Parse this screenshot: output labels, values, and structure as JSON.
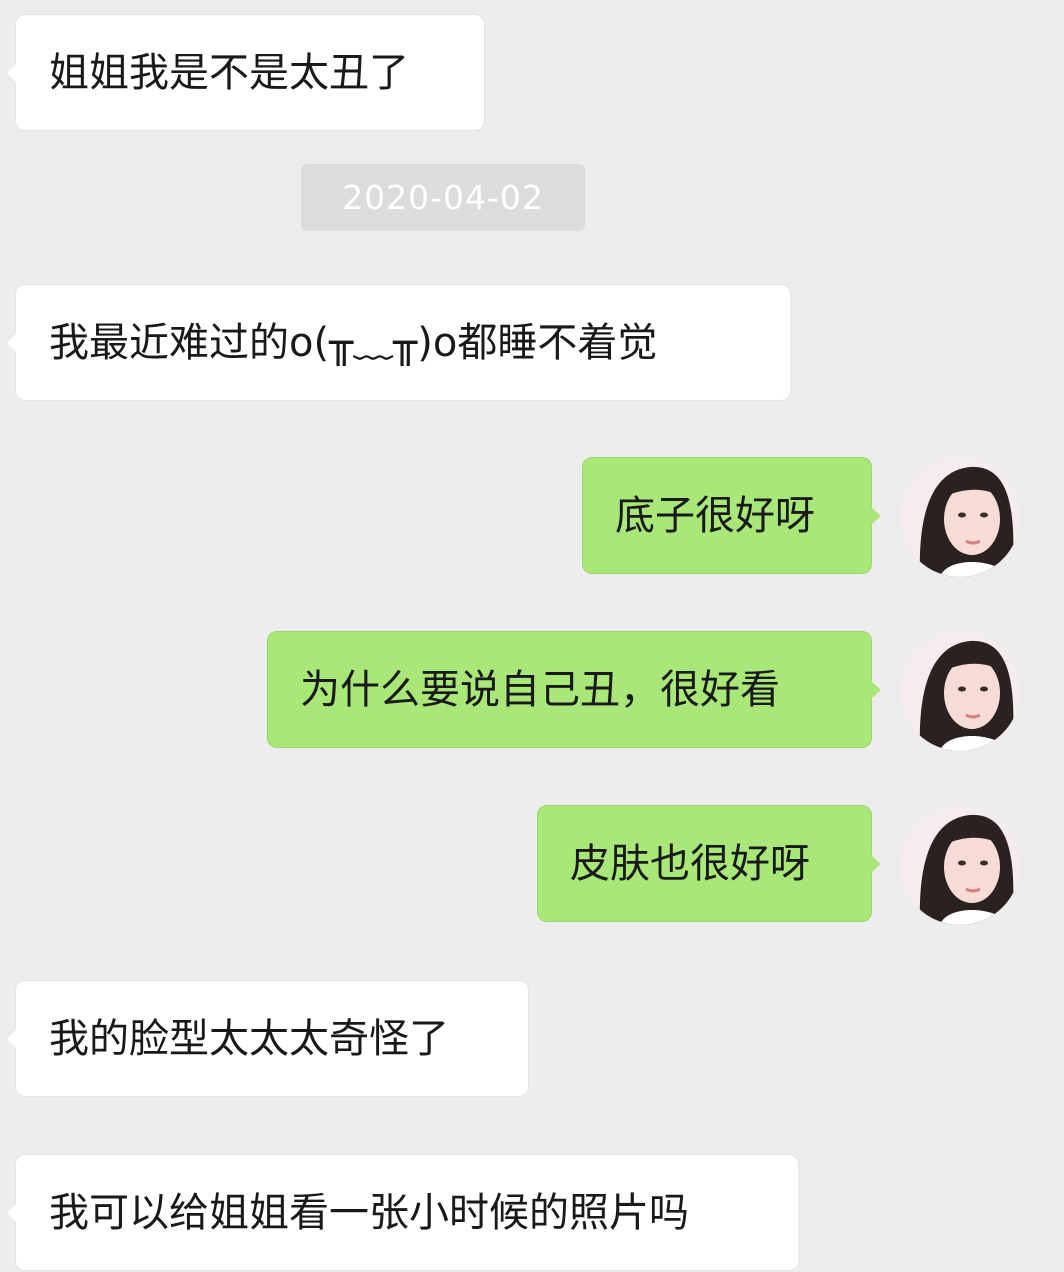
{
  "chat": {
    "timestamp": "2020-04-02",
    "messages": [
      {
        "side": "left",
        "text": "姐姐我是不是太丑了"
      },
      {
        "side": "left",
        "text": "我最近难过的o(╥﹏╥)o都睡不着觉"
      },
      {
        "side": "right",
        "text": "底子很好呀"
      },
      {
        "side": "right",
        "text": "为什么要说自己丑，很好看"
      },
      {
        "side": "right",
        "text": "皮肤也很好呀"
      },
      {
        "side": "left",
        "text": "我的脸型太太太奇怪了"
      },
      {
        "side": "left",
        "text": "我可以给姐姐看一张小时候的照片吗"
      }
    ],
    "avatar_icon": "woman-portrait-avatar",
    "colors": {
      "background": "#ededed",
      "incoming_bubble": "#ffffff",
      "outgoing_bubble": "#a9e878",
      "timestamp_bg": "#dcdcdc"
    }
  }
}
